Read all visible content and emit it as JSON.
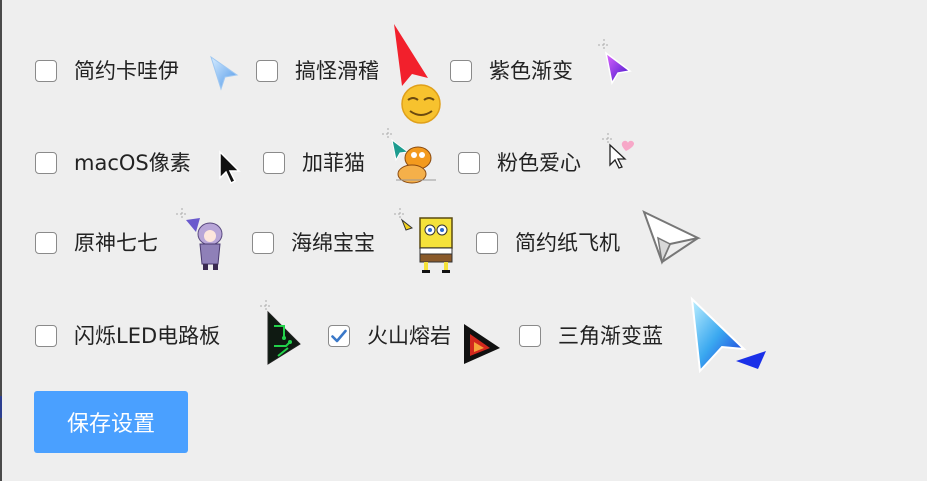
{
  "cursor_options": [
    {
      "label": "简约卡哇伊",
      "checked": false,
      "icon": "blue-arrow-cursor-icon"
    },
    {
      "label": "搞怪滑稽",
      "checked": false,
      "icon": "red-arrow-smiley-cursor-icon"
    },
    {
      "label": "紫色渐变",
      "checked": false,
      "icon": "purple-gradient-cursor-icon"
    },
    {
      "label": "macOS像素",
      "checked": false,
      "icon": "macos-pixel-cursor-icon"
    },
    {
      "label": "加菲猫",
      "checked": false,
      "icon": "garfield-cursor-icon"
    },
    {
      "label": "粉色爱心",
      "checked": false,
      "icon": "pink-heart-cursor-icon"
    },
    {
      "label": "原神七七",
      "checked": false,
      "icon": "genshin-qiqi-cursor-icon"
    },
    {
      "label": "海绵宝宝",
      "checked": false,
      "icon": "spongebob-cursor-icon"
    },
    {
      "label": "简约纸飞机",
      "checked": false,
      "icon": "paper-plane-cursor-icon"
    },
    {
      "label": "闪烁LED电路板",
      "checked": false,
      "icon": "led-circuit-cursor-icon"
    },
    {
      "label": "火山熔岩",
      "checked": true,
      "icon": "volcano-lava-cursor-icon"
    },
    {
      "label": "三角渐变蓝",
      "checked": false,
      "icon": "blue-triangle-gradient-cursor-icon"
    }
  ],
  "save_button": {
    "label": "保存设置"
  },
  "colors": {
    "background": "#eeeeee",
    "button": "#4aa0ff",
    "checkmark": "#3a78c8"
  }
}
